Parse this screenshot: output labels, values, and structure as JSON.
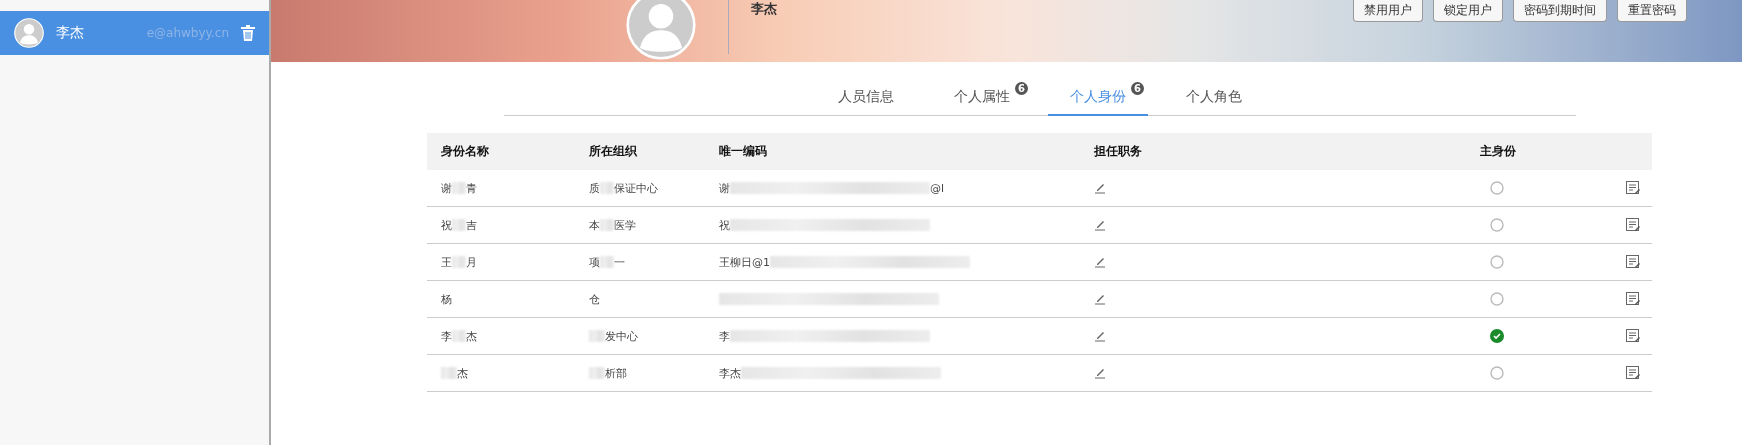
{
  "sidebar": {
    "items": [
      {
        "name": "李杰",
        "email": "e@ahwbyy.cn",
        "selected": true
      }
    ]
  },
  "profile": {
    "name": "李杰",
    "buttons": [
      "禁用用户",
      "锁定用户",
      "密码到期时间",
      "重置密码"
    ]
  },
  "tabs": [
    {
      "label": "人员信息",
      "selected": false
    },
    {
      "label": "个人属性",
      "badge": "6",
      "selected": false
    },
    {
      "label": "个人身份",
      "badge": "6",
      "selected": true
    },
    {
      "label": "个人角色",
      "selected": false
    }
  ],
  "table": {
    "columns": [
      "身份名称",
      "所在组织",
      "唯一编码",
      "担任职务",
      "主身份"
    ],
    "rows": [
      {
        "cells": [
          {
            "parts": [
              "谢",
              "青"
            ]
          },
          {
            "parts": [
              "质",
              "保证中心"
            ]
          },
          {
            "parts": [
              "谢",
              "@l"
            ]
          }
        ],
        "primary": false
      },
      {
        "cells": [
          {
            "parts": [
              "祝",
              "吉"
            ]
          },
          {
            "parts": [
              "本",
              "医学"
            ]
          },
          {
            "parts": [
              "祝"
            ]
          }
        ],
        "primary": false
      },
      {
        "cells": [
          {
            "parts": [
              "王",
              "月"
            ]
          },
          {
            "parts": [
              "项",
              "一"
            ]
          },
          {
            "parts": [
              "王柳日@1"
            ]
          }
        ],
        "primary": false
      },
      {
        "cells": [
          {
            "parts": [
              "杨"
            ]
          },
          {
            "parts": [
              "仓"
            ]
          },
          {
            "lead": true
          }
        ],
        "primary": false
      },
      {
        "cells": [
          {
            "parts": [
              "李",
              "杰"
            ]
          },
          {
            "parts": [
              "发中心"
            ],
            "lead": true
          },
          {
            "parts": [
              "李"
            ]
          }
        ],
        "primary": true
      },
      {
        "cells": [
          {
            "parts": [
              "杰"
            ],
            "lead": true
          },
          {
            "parts": [
              "析部"
            ],
            "lead": true
          },
          {
            "parts": [
              "李杰"
            ]
          }
        ],
        "primary": false
      }
    ]
  }
}
